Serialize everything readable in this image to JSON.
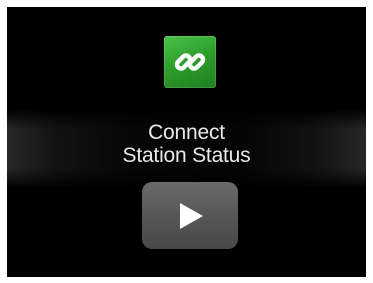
{
  "heading": {
    "line1": "Connect",
    "line2": "Station Status"
  },
  "icons": {
    "top": "link-icon",
    "button": "play-icon"
  },
  "colors": {
    "background": "#000000",
    "tile_green": "#2f9f2d",
    "button_gray": "#5a5a5a",
    "text": "#e9e9e9"
  }
}
